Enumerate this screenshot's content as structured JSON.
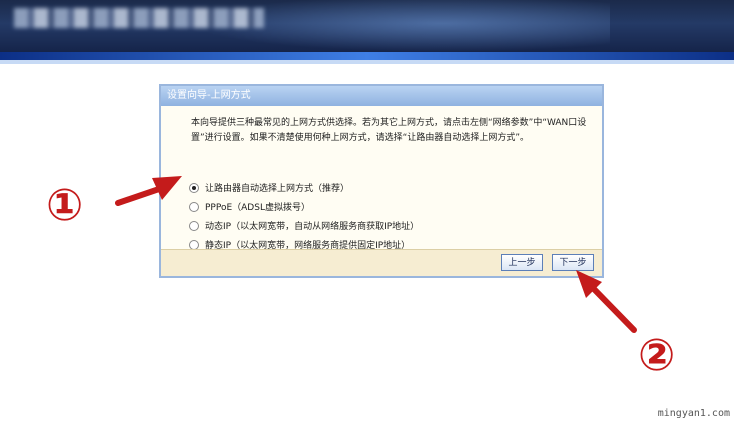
{
  "dialog": {
    "title": "设置向导-上网方式",
    "description": "本向导提供三种最常见的上网方式供选择。若为其它上网方式，请点击左侧“网络参数”中“WAN口设置”进行设置。如果不清楚使用何种上网方式，请选择“让路由器自动选择上网方式”。",
    "options": [
      {
        "label": "让路由器自动选择上网方式（推荐）",
        "selected": true
      },
      {
        "label": "PPPoE（ADSL虚拟拨号）",
        "selected": false
      },
      {
        "label": "动态IP（以太网宽带，自动从网络服务商获取IP地址）",
        "selected": false
      },
      {
        "label": "静态IP（以太网宽带，网络服务商提供固定IP地址）",
        "selected": false
      }
    ],
    "buttons": {
      "prev": "上一步",
      "next": "下一步"
    }
  },
  "annotations": {
    "marker_1": "①",
    "marker_2": "②",
    "color": "#c41b1b"
  },
  "watermark": "mingyan1.com"
}
